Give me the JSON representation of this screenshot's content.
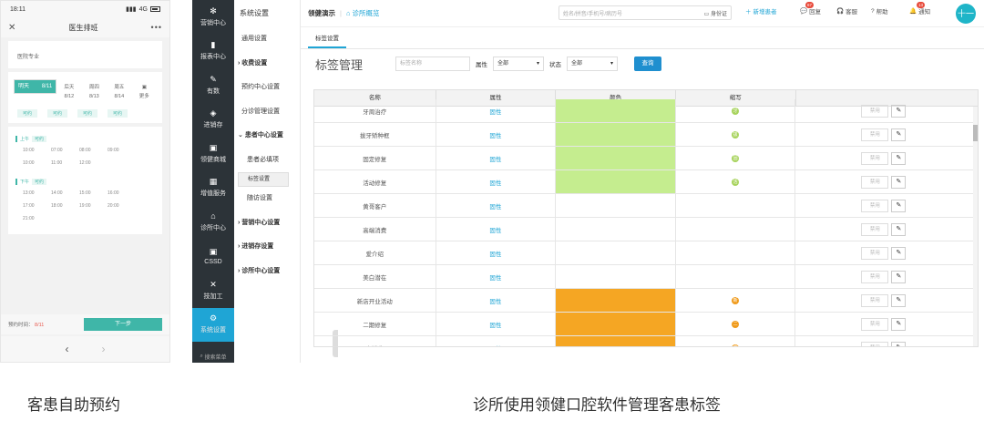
{
  "phone": {
    "status_time": "18:11",
    "status_network": "4G",
    "nav_title": "医生排班",
    "close_icon": "close-icon",
    "more_icon": "more-icon",
    "doctor_label": "医院专业",
    "days": [
      {
        "week": "明天",
        "date": "8/11",
        "selected": true
      },
      {
        "week": "后天",
        "date": "8/12",
        "selected": false
      },
      {
        "week": "周四",
        "date": "8/13",
        "selected": false
      },
      {
        "week": "周五",
        "date": "8/14",
        "selected": false
      },
      {
        "week": "更多",
        "date": "",
        "selected": false
      }
    ],
    "day_tags": [
      "可约",
      "可约",
      "可约",
      "可约"
    ],
    "morning_label": "上午",
    "morning_badge": "可约",
    "morning_times": [
      "10:00",
      "07:00",
      "08:00",
      "09:00",
      "10:00",
      "11:00",
      "12:00"
    ],
    "afternoon_label": "下午",
    "afternoon_badge": "可约",
    "afternoon_times": [
      "13:00",
      "14:00",
      "15:00",
      "16:00",
      "17:00",
      "18:00",
      "19:00",
      "20:00",
      "21:00"
    ],
    "footer_label": "预约时间：",
    "footer_value": "8/11",
    "next_button": "下一步"
  },
  "desktop": {
    "sidebar": [
      {
        "icon": "gear-icon",
        "label": "营销中心"
      },
      {
        "icon": "chart-icon",
        "label": "报表中心"
      },
      {
        "icon": "edit-icon",
        "label": "有数"
      },
      {
        "icon": "layers-icon",
        "label": "进销存"
      },
      {
        "icon": "mall-icon",
        "label": "领健商城"
      },
      {
        "icon": "grid-icon",
        "label": "增值服务"
      },
      {
        "icon": "home-icon",
        "label": "诊所中心"
      },
      {
        "icon": "box-icon",
        "label": "CSSD"
      },
      {
        "icon": "tool-icon",
        "label": "技加工"
      },
      {
        "icon": "settings-icon",
        "label": "系统设置",
        "active": true
      }
    ],
    "sidebar_search": "搜索菜单",
    "submenu_title": "系统设置",
    "submenu": [
      {
        "label": "通用设置",
        "type": "item"
      },
      {
        "label": "收费设置",
        "type": "grp",
        "arrow": "›"
      },
      {
        "label": "预约中心设置",
        "type": "item"
      },
      {
        "label": "分诊管理设置",
        "type": "item"
      },
      {
        "label": "患者中心设置",
        "type": "grp",
        "arrow": "⌄"
      },
      {
        "label": "患者必填项",
        "type": "sub"
      },
      {
        "label": "标签设置",
        "type": "sub",
        "selected": true
      },
      {
        "label": "随访设置",
        "type": "sub"
      },
      {
        "label": "营销中心设置",
        "type": "grp",
        "arrow": "›"
      },
      {
        "label": "进销存设置",
        "type": "grp",
        "arrow": "›"
      },
      {
        "label": "诊所中心设置",
        "type": "grp",
        "arrow": "›"
      }
    ],
    "topbar": {
      "brand": "领健演示",
      "clinic": "诊所概览",
      "search_placeholder": "姓名/拼音/手机号/病历号",
      "id_card": "身份证",
      "new_patient": "新增患者",
      "msg": "回复",
      "msg_badge": "67",
      "service": "客服",
      "help": "帮助",
      "notice": "通知",
      "notice_badge": "13",
      "avatar": "十一"
    },
    "tab": "标签设置",
    "page_title": "标签管理",
    "filter": {
      "name_placeholder": "标签名称",
      "attr_label": "属性",
      "attr_value": "全部",
      "status_label": "状态",
      "status_value": "全部",
      "query_button": "查询"
    },
    "columns": [
      "名称",
      "属性",
      "颜色",
      "缩写",
      ""
    ],
    "rows": [
      {
        "name": "牙周治疗",
        "attr": "固性",
        "color": "#c5ed8f",
        "abbr": "牙",
        "abbr_color": "#a7d35c"
      },
      {
        "name": "拔牙矫种框",
        "attr": "固性",
        "color": "#c5ed8f",
        "abbr": "拔",
        "abbr_color": "#a7d35c"
      },
      {
        "name": "固定修复",
        "attr": "固性",
        "color": "#c5ed8f",
        "abbr": "固",
        "abbr_color": "#a7d35c"
      },
      {
        "name": "活动修复",
        "attr": "固性",
        "color": "#c5ed8f",
        "abbr": "活",
        "abbr_color": "#a7d35c"
      },
      {
        "name": "黄哥客户",
        "attr": "固性",
        "color": "",
        "abbr": "",
        "abbr_color": ""
      },
      {
        "name": "高端消费",
        "attr": "固性",
        "color": "",
        "abbr": "",
        "abbr_color": ""
      },
      {
        "name": "爱介绍",
        "attr": "固性",
        "color": "",
        "abbr": "",
        "abbr_color": ""
      },
      {
        "name": "美白潜在",
        "attr": "固性",
        "color": "",
        "abbr": "",
        "abbr_color": ""
      },
      {
        "name": "新店开业活动",
        "attr": "固性",
        "color": "#f5a623",
        "abbr": "新",
        "abbr_color": "#f09a1a"
      },
      {
        "name": "二期修复",
        "attr": "固性",
        "color": "#f5a623",
        "abbr": "二",
        "abbr_color": "#f09a1a"
      },
      {
        "name": "高消费",
        "attr": "固性",
        "color": "#f5a623",
        "abbr": "高",
        "abbr_color": "#f09a1a"
      }
    ],
    "op_disable": "禁用",
    "op_edit_icon": "pencil-icon"
  },
  "captions": {
    "left": "客患自助预约",
    "right": "诊所使用领健口腔软件管理客患标签"
  }
}
